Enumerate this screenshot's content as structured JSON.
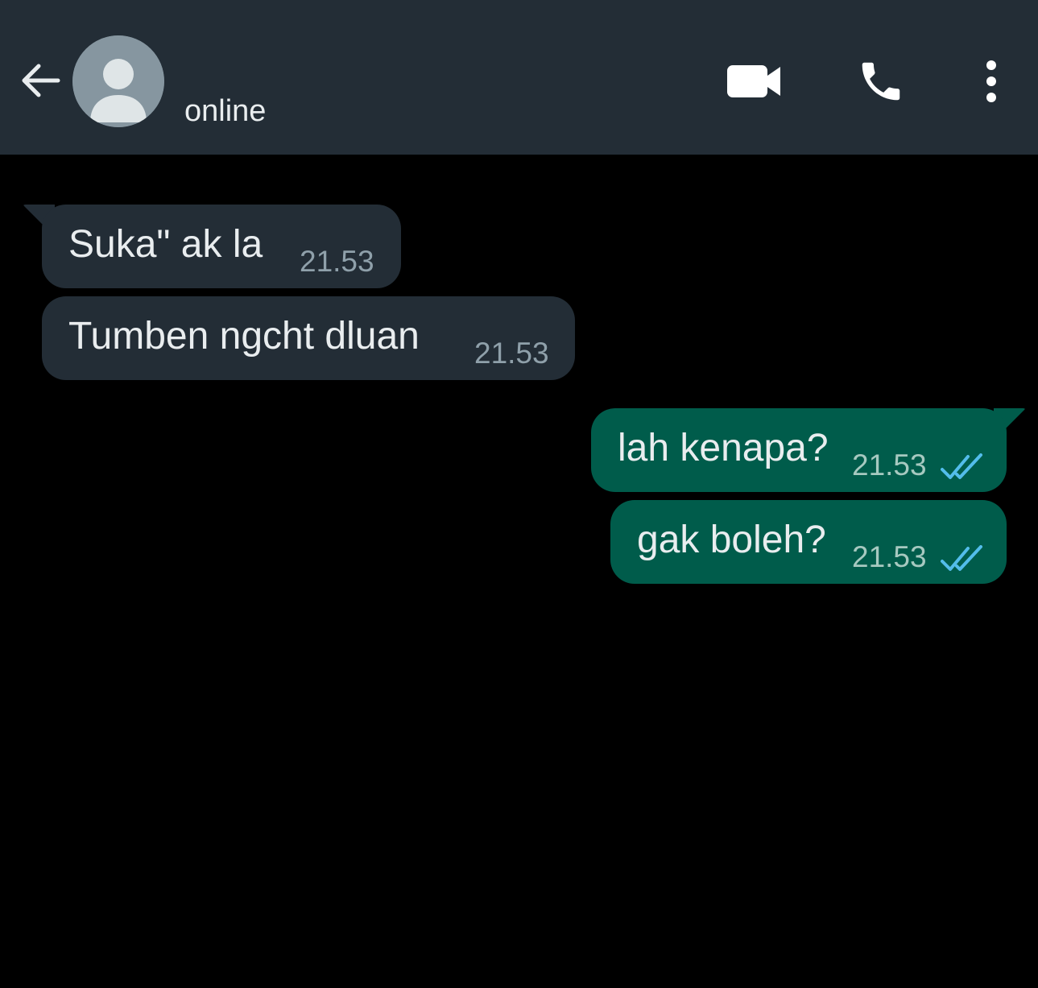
{
  "header": {
    "status": "online",
    "background": "#232d36",
    "icons": {
      "back": "arrow-left-icon",
      "avatar": "default-avatar-icon",
      "video": "video-camera-icon",
      "call": "phone-icon",
      "menu": "more-vertical-icon"
    }
  },
  "colors": {
    "incoming_bubble": "#232d36",
    "outgoing_bubble": "#005c4b",
    "read_ticks": "#53bdeb",
    "chat_background": "#000000"
  },
  "messages": [
    {
      "direction": "incoming",
      "text": "Suka\" ak la",
      "time": "21.53"
    },
    {
      "direction": "incoming",
      "text": "Tumben ngcht dluan",
      "time": "21.53"
    },
    {
      "direction": "outgoing",
      "text": "lah kenapa?",
      "time": "21.53",
      "status": "read"
    },
    {
      "direction": "outgoing",
      "text": "gak boleh?",
      "time": "21.53",
      "status": "read"
    }
  ]
}
